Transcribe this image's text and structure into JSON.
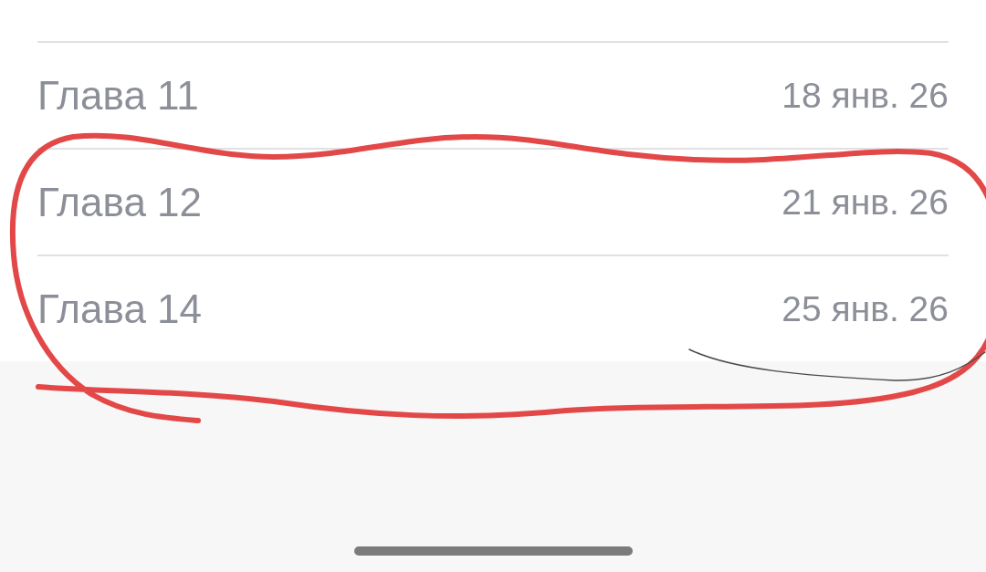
{
  "chapters": [
    {
      "title": "Глава 11",
      "date": "18 янв. 26"
    },
    {
      "title": "Глава 12",
      "date": "21 янв. 26"
    },
    {
      "title": "Глава 14",
      "date": "25 янв. 26"
    }
  ],
  "annotations": [
    {
      "kind": "loop"
    },
    {
      "kind": "curve"
    }
  ]
}
